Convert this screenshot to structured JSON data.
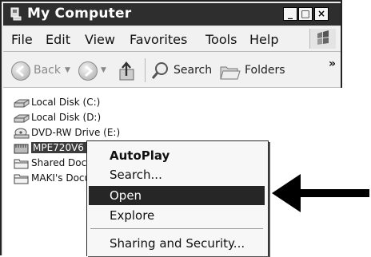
{
  "window": {
    "title": "My Computer",
    "controls": [
      "_",
      "□",
      "×"
    ]
  },
  "menubar": {
    "items": [
      "File",
      "Edit",
      "View",
      "Favorites",
      "Tools",
      "Help"
    ]
  },
  "toolbar": {
    "back_label": "Back",
    "search_label": "Search",
    "folders_label": "Folders",
    "more": "»"
  },
  "drives": [
    {
      "label": "Local Disk (C:)",
      "icon": "hard-disk-icon"
    },
    {
      "label": "Local Disk (D:)",
      "icon": "hard-disk-icon"
    },
    {
      "label": "DVD-RW Drive (E:)",
      "icon": "dvd-drive-icon"
    },
    {
      "label": "MPE720V6 (",
      "icon": "removable-disk-icon"
    },
    {
      "label": "Shared Docu",
      "icon": "folder-icon"
    },
    {
      "label": "MAKI's Docu",
      "icon": "folder-icon"
    }
  ],
  "context_menu": {
    "items": [
      "AutoPlay",
      "Search...",
      "Open",
      "Explore",
      "Sharing and Security..."
    ],
    "default": "AutoPlay",
    "highlighted": "Open"
  }
}
